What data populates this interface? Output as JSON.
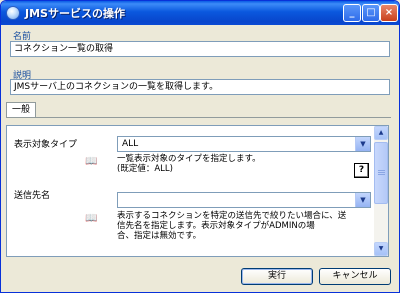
{
  "window": {
    "title": "JMSサービスの操作"
  },
  "fields": {
    "name_label": "名前",
    "name_value": "コネクション一覧の取得",
    "desc_label": "説明",
    "desc_value": "JMSサーバ上のコネクションの一覧を取得します。"
  },
  "tab": {
    "label": "一般"
  },
  "properties": [
    {
      "label": "表示対象タイプ",
      "value": "ALL",
      "description_line1": "一覧表示対象のタイプを指定します。",
      "description_line2": "(既定値：ALL)"
    },
    {
      "label": "送信先名",
      "value": "",
      "description_line1": "表示するコネクションを特定の送信先で絞りたい場合に、送",
      "description_line2": "信先名を指定します。表示対象タイプがADMINの場",
      "description_line3": "合、指定は無効です。"
    }
  ],
  "buttons": {
    "ok": "実行",
    "cancel": "キャンセル"
  },
  "help_glyph": "?",
  "icons": [
    "window-icon",
    "book-icon",
    "help-icon",
    "dropdown-arrow-icon"
  ]
}
